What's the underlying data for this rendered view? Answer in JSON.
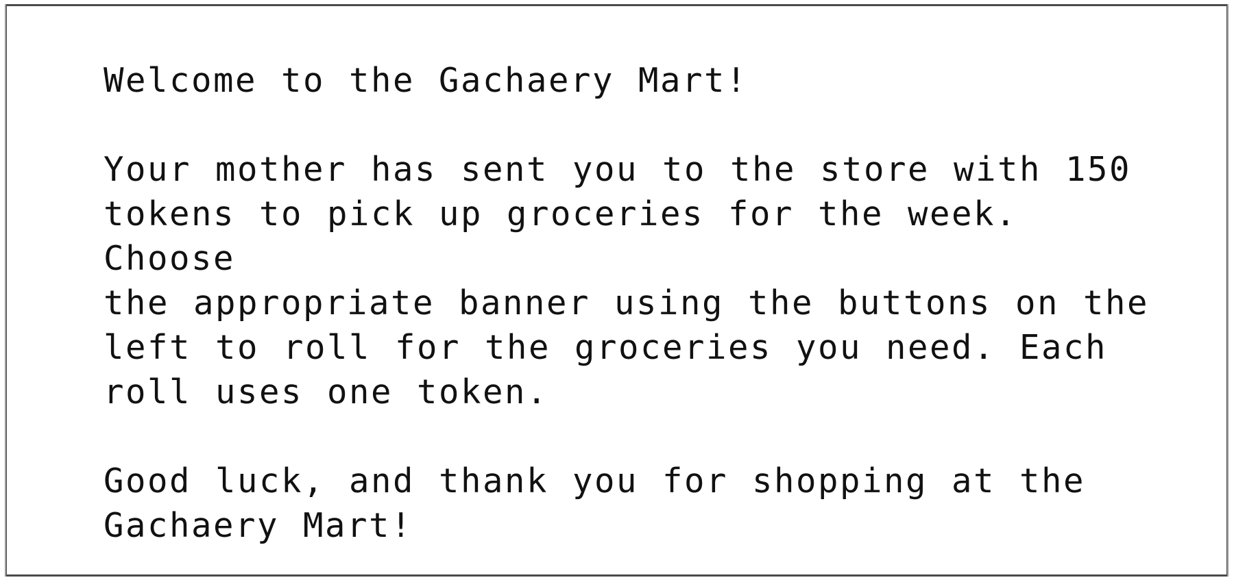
{
  "dialog": {
    "welcome": "Welcome to the Gachaery Mart!",
    "instructions": "Your mother has sent you to the store with 150\ntokens to pick up groceries for the week. Choose\nthe appropriate banner using the buttons on the\nleft to roll for the groceries you need. Each\nroll uses one token.",
    "farewell": "Good luck, and thank you for shopping at the\nGachaery Mart!"
  }
}
